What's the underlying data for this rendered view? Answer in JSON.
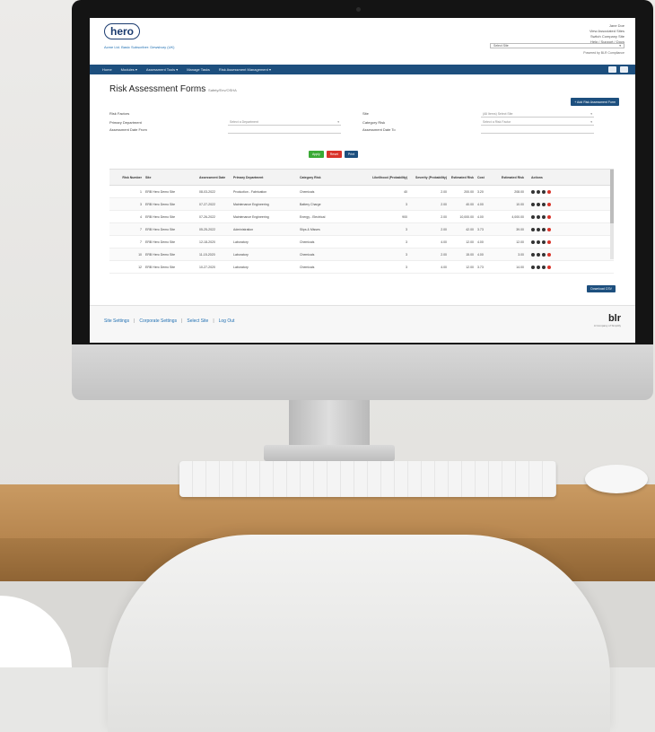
{
  "app": {
    "logo_text": "hero",
    "company_line": "Acme Ltd. Basic Subscriber: Dewsbury (UK)",
    "header_right": [
      "Jane Doe",
      "View Associated Sites",
      "Switch Company Site",
      "Help / Support / Docs"
    ],
    "site_select": {
      "value": "Select Site",
      "caret": "▾"
    },
    "sub_line": "Powered by BLR Compliance"
  },
  "nav": {
    "items": [
      "Home",
      "Modules ▾",
      "Assessment Tools ▾",
      "Manage Tasks",
      "Risk Assessment Management ▾"
    ],
    "icon_names": [
      "bell-icon",
      "user-icon"
    ]
  },
  "page": {
    "title": "Risk Assessment Forms",
    "subtitle": "Safety/Env/OSHA",
    "add_button": "+ Add Risk Assessment Form"
  },
  "filters": {
    "labels": {
      "risk_factors": "Risk Factors",
      "primary_department": "Primary Department",
      "assessment_date_from": "Assessment Date From",
      "site": "Site",
      "category_risk": "Category Risk",
      "assessment_date_to": "Assessment Date To"
    },
    "values": {
      "department": "Select a Department",
      "site": "(All Items) Select Site",
      "category": "Select a Risk Factor"
    },
    "caret": "▾"
  },
  "buttons": {
    "apply": "Apply",
    "reset": "Reset",
    "print": "Print"
  },
  "table": {
    "headers": [
      "Risk Number",
      "Site",
      "Assessment Date",
      "Primary Department",
      "Category Risk",
      "Likelihood (Probability)",
      "Severity (Probability)",
      "Estimated Risk",
      "Cost",
      "Estimated Risk",
      "Actions"
    ],
    "rows": [
      [
        "1",
        "ERB Hero Demo Site",
        "08-03-2022",
        "Production - Fabrication",
        "Chemicals",
        "40",
        "2.00",
        "200.00",
        "3.20",
        "208.00"
      ],
      [
        "3",
        "ERB Hero Demo Site",
        "07-27-2022",
        "Maintenance Engineering",
        "Battery Charge",
        "3",
        "2.00",
        "40.00",
        "4.00",
        "10.00"
      ],
      [
        "4",
        "ERB Hero Demo Site",
        "07-26-2022",
        "Maintenance Engineering",
        "Energy - Electrical",
        "900",
        "2.00",
        "10,000.00",
        "4.00",
        "4,000.00"
      ],
      [
        "7",
        "ERB Hero Demo Site",
        "05-25-2022",
        "Administration",
        "Slips & Misses",
        "3",
        "2.00",
        "42.00",
        "3.73",
        "39.00"
      ],
      [
        "7",
        "ERB Hero Demo Site",
        "12-18-2020",
        "Laboratory",
        "Chemicals",
        "3",
        "4.00",
        "12.00",
        "4.00",
        "12.00"
      ],
      [
        "10",
        "ERB Hero Demo Site",
        "11-15-2020",
        "Laboratory",
        "Chemicals",
        "3",
        "2.00",
        "15.00",
        "4.00",
        "3.00"
      ],
      [
        "12",
        "ERB Hero Demo Site",
        "10-27-2020",
        "Laboratory",
        "Chemicals",
        "3",
        "4.00",
        "12.00",
        "3.73",
        "14.00"
      ]
    ],
    "download_button": "Download CSV"
  },
  "footer": {
    "links": [
      "Site Settings",
      "Corporate Settings",
      "Select Site",
      "Log Out"
    ],
    "separator": "|",
    "brand_mark": "blr",
    "brand_tag": "A Company of Simplify"
  },
  "colors": {
    "nav_bg": "#1d4f7e",
    "apply": "#3aaa35",
    "reset": "#d9342b",
    "print": "#1d4f7e",
    "link": "#1f6fb2",
    "action_edit": "#333333",
    "action_delete": "#d9342b"
  }
}
